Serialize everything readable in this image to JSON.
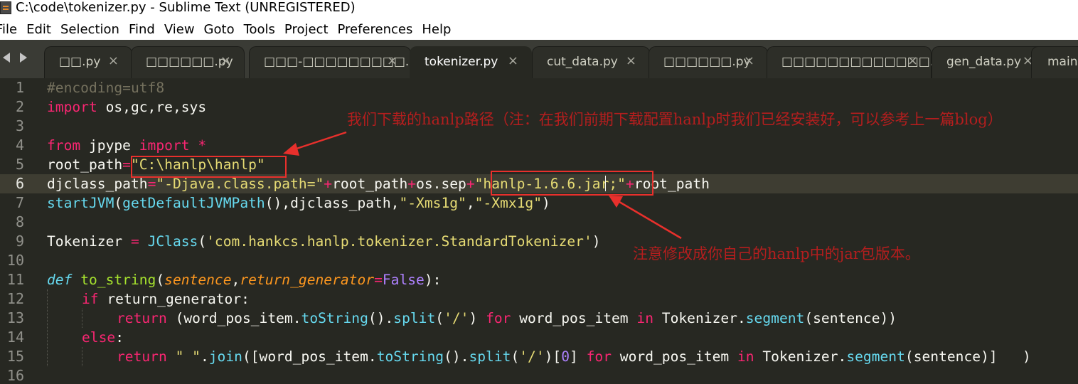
{
  "window": {
    "title": "C:\\code\\tokenizer.py - Sublime Text (UNREGISTERED)"
  },
  "menu": [
    "File",
    "Edit",
    "Selection",
    "Find",
    "View",
    "Goto",
    "Tools",
    "Project",
    "Preferences",
    "Help"
  ],
  "tabs": [
    {
      "label": "□□.py",
      "close": "×",
      "active": false
    },
    {
      "label": "□□□□□□.py",
      "close": "×",
      "active": false
    },
    {
      "label": "□□□-□□□□□□□□□.py",
      "close": "×",
      "active": false
    },
    {
      "label": "tokenizer.py",
      "close": "×",
      "active": true
    },
    {
      "label": "cut_data.py",
      "close": "×",
      "active": false
    },
    {
      "label": "□□□□□□.py",
      "close": "×",
      "active": false
    },
    {
      "label": "□□□□□□□□□□□□□.py",
      "close": "×",
      "active": false
    },
    {
      "label": "gen_data.py",
      "close": "×",
      "active": false
    },
    {
      "label": "main.py",
      "close": "×",
      "active": false
    }
  ],
  "editor": {
    "current_line": 6,
    "line_numbers": [
      "1",
      "2",
      "3",
      "4",
      "5",
      "6",
      "7",
      "8",
      "9",
      "10",
      "11",
      "12",
      "13",
      "14",
      "15",
      "16"
    ],
    "code": {
      "l1": {
        "comment": "#encoding=utf8"
      },
      "l2": {
        "kw": "import",
        "rest": " os,gc,re,sys"
      },
      "l4": {
        "kw1": "from",
        "mod": " jpype ",
        "kw2": "import",
        "star": " *"
      },
      "l5": {
        "name": "root_path",
        "eq": "=",
        "str": "\"C:\\hanlp\\hanlp\""
      },
      "l6": {
        "name": "djclass_path",
        "eq": "=",
        "str1": "\"-Djava.class.path=\"",
        "plus1": "+",
        "mid": "root_path",
        "plus2": "+",
        "mid2": "os.sep",
        "plus3": "+",
        "str2": "\"hanlp-1.6.6.jar;\"",
        "plus4": "+",
        "end": "root_path"
      },
      "l7": {
        "fn1": "startJVM",
        "p1": "(",
        "fn2": "getDefaultJVMPath",
        "p2": "(),djclass_path,",
        "s1": "\"-Xms1g\"",
        "comma": ",",
        "s2": "\"-Xmx1g\"",
        "p3": ")"
      },
      "l9": {
        "name": "Tokenizer ",
        "eq": "=",
        "sp": " ",
        "cls": "JClass",
        "p1": "(",
        "str": "'com.hankcs.hanlp.tokenizer.StandardTokenizer'",
        "p2": ")"
      },
      "l11": {
        "kw": "def",
        "sp": " ",
        "fn": "to_string",
        "p1": "(",
        "a1": "sentence",
        "comma": ",",
        "a2": "return_generator",
        "eq": "=",
        "val": "False",
        "p2": "):"
      },
      "l12": {
        "kw": "if",
        "rest": " return_generator:"
      },
      "l13": {
        "kw1": "return",
        "r1": " (word_pos_item.",
        "m1": "toString",
        "r2": "().",
        "m2": "split",
        "r3": "(",
        "s1": "'/'",
        "r4": ") ",
        "kw2": "for",
        "r5": " word_pos_item ",
        "kw3": "in",
        "r6": " Tokenizer.",
        "m3": "segment",
        "r7": "(sentence))"
      },
      "l14": {
        "kw": "else",
        "rest": ":"
      },
      "l15": {
        "kw1": "return",
        "sp": " ",
        "s1": "\" \"",
        "r1": ".",
        "m1": "join",
        "r2": "([word_pos_item.",
        "m2": "toString",
        "r3": "().",
        "m3": "split",
        "r4": "(",
        "s2": "'/'",
        "r5": ")[",
        "n": "0",
        "r6": "] ",
        "kw2": "for",
        "r7": " word_pos_item ",
        "kw3": "in",
        "r8": " Tokenizer.",
        "m4": "segment",
        "r9": "(sentence)]   )"
      }
    }
  },
  "annotations": {
    "note1": "我们下载的hanlp路径（注：在我们前期下载配置hanlp时我们已经安装好，可以参考上一篇blog）",
    "note2": "注意修改成你自己的hanlp中的jar包版本。",
    "color": "#e8302c"
  },
  "colors": {
    "editor_bg": "#272822",
    "tabbar_bg": "#3a3b35",
    "keyword": "#f92672",
    "string": "#e6db74",
    "function": "#a6e22e",
    "builtin": "#66d9ef",
    "comment": "#75715e"
  }
}
